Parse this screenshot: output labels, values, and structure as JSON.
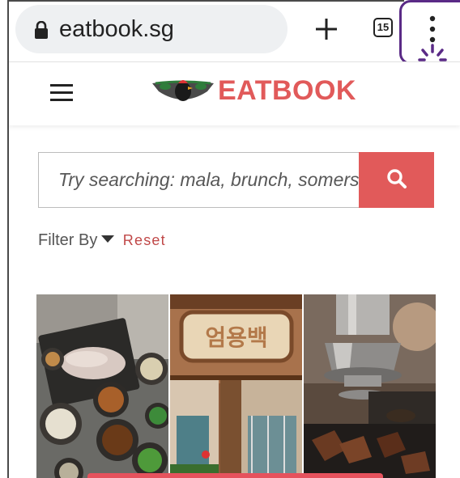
{
  "browser": {
    "url": "eatbook.sg",
    "tab_count": "15",
    "icons": {
      "lock": "lock-icon",
      "new_tab": "plus-icon",
      "tabs": "tab-switcher-icon",
      "menu": "more-vertical-icon",
      "tap_hint": "tap-hand-icon"
    },
    "highlight_color": "#5a2a86"
  },
  "site": {
    "logo_text": "EATBOOK",
    "brand_color": "#e15a5a",
    "icons": {
      "menu": "hamburger-icon",
      "logo": "rooster-bowl-logo"
    }
  },
  "search": {
    "placeholder": "Try searching: mala, brunch, somerset..",
    "value": "",
    "button_icon": "search-icon"
  },
  "filter": {
    "label": "Filter By",
    "caret_icon": "caret-down-icon",
    "reset_label": "Reset"
  },
  "collage": {
    "photos": [
      {
        "name": "korean-food-spread-photo"
      },
      {
        "name": "korean-restaurant-sign-photo",
        "sign_text": "엄용백"
      },
      {
        "name": "grilled-meat-photo"
      }
    ]
  }
}
